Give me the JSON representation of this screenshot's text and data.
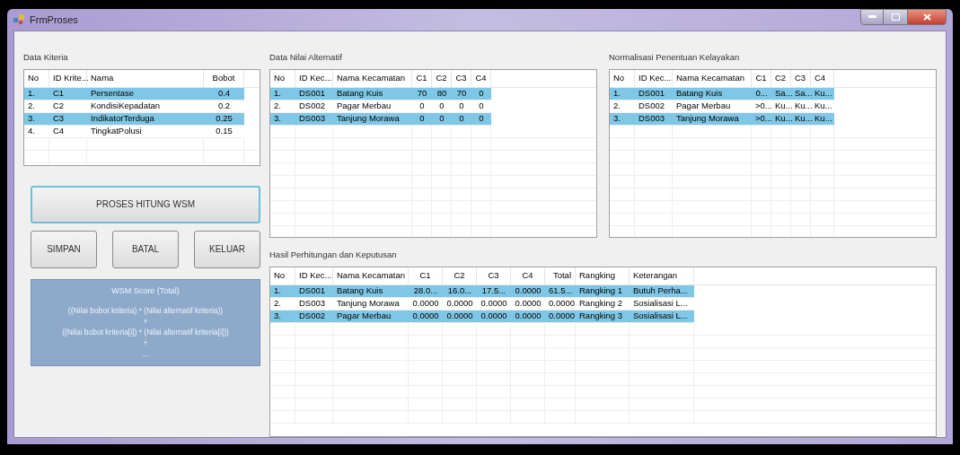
{
  "window": {
    "title": "FrmProses"
  },
  "criteria": {
    "title": "Data Kiteria",
    "columns": [
      "No",
      "ID Krite...",
      "Nama",
      "Bobot"
    ],
    "rows": [
      {
        "cells": [
          "1.",
          "C1",
          "Persentase",
          "0.4"
        ],
        "selected": true
      },
      {
        "cells": [
          "2.",
          "C2",
          "KondisiKepadatan",
          "0.2"
        ],
        "selected": false
      },
      {
        "cells": [
          "3.",
          "C3",
          "IndikatorTerduga",
          "0.25"
        ],
        "selected": true
      },
      {
        "cells": [
          "4.",
          "C4",
          "TingkatPolusi",
          "0.15"
        ],
        "selected": false
      }
    ]
  },
  "buttons": {
    "process": "PROSES HITUNG WSM",
    "actions": [
      "SIMPAN",
      "BATAL",
      "KELUAR"
    ]
  },
  "formula": {
    "title": "WSM Score (Total)",
    "lines": [
      "((Nilai bobot kriteria) * (Nilai alternatif kriteria))",
      "+",
      "((Nilai bobot kriteria[i]) * (Nilai alternatif kriteria[i]))",
      "+",
      "..."
    ]
  },
  "alternatives": {
    "title": "Data Nilai Alternatif",
    "columns": [
      "No",
      "ID Kec...",
      "Nama Kecamatan",
      "C1",
      "C2",
      "C3",
      "C4"
    ],
    "rows": [
      {
        "cells": [
          "1.",
          "DS001",
          "Batang Kuis",
          "70",
          "80",
          "70",
          "0"
        ],
        "selected": true
      },
      {
        "cells": [
          "2.",
          "DS002",
          "Pagar Merbau",
          "0",
          "0",
          "0",
          "0"
        ],
        "selected": false
      },
      {
        "cells": [
          "3.",
          "DS003",
          "Tanjung Morawa",
          "0",
          "0",
          "0",
          "0"
        ],
        "selected": true
      }
    ]
  },
  "normalization": {
    "title": "Normalisasi Penentuan Kelayakan",
    "columns": [
      "No",
      "ID Kec...",
      "Nama Kecamatan",
      "C1",
      "C2",
      "C3",
      "C4"
    ],
    "rows": [
      {
        "cells": [
          "1.",
          "DS001",
          "Batang Kuis",
          "0...",
          "Sa...",
          "Sa...",
          "Ku..."
        ],
        "selected": true
      },
      {
        "cells": [
          "2.",
          "DS002",
          "Pagar Merbau",
          ">0...",
          "Ku...",
          "Ku...",
          "Ku..."
        ],
        "selected": false
      },
      {
        "cells": [
          "3.",
          "DS003",
          "Tanjung Morawa",
          ">0...",
          "Ku...",
          "Ku...",
          "Ku..."
        ],
        "selected": true
      }
    ]
  },
  "results": {
    "title": "Hasil Perhitungan dan Keputusan",
    "columns": [
      "No",
      "ID Kec...",
      "Nama Kecamatan",
      "C1",
      "C2",
      "C3",
      "C4",
      "Total",
      "Rangking",
      "Keterangan"
    ],
    "rows": [
      {
        "cells": [
          "1.",
          "DS001",
          "Batang Kuis",
          "28.0...",
          "16.0...",
          "17.5...",
          "0.0000",
          "61.5...",
          "Rangking 1",
          "Butuh Perha..."
        ],
        "selected": true
      },
      {
        "cells": [
          "2.",
          "DS003",
          "Tanjung Morawa",
          "0.0000",
          "0.0000",
          "0.0000",
          "0.0000",
          "0.0000",
          "Rangking 2",
          "Sosialisasi L..."
        ],
        "selected": false
      },
      {
        "cells": [
          "3.",
          "DS002",
          "Pagar Merbau",
          "0.0000",
          "0.0000",
          "0.0000",
          "0.0000",
          "0.0000",
          "Rangking 3",
          "Sosialisasi L..."
        ],
        "selected": true
      }
    ]
  }
}
